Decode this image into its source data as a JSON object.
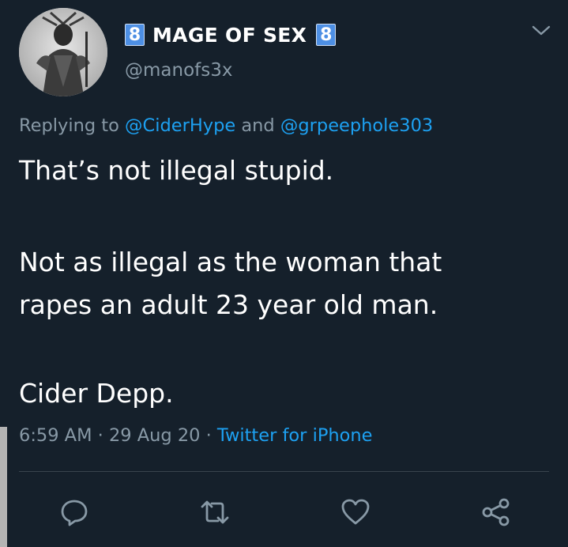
{
  "tweet": {
    "badge_left": "8",
    "display_name": "MAGE OF SEX",
    "badge_right": "8",
    "handle": "@manofs3x",
    "reply_prefix": "Replying to",
    "reply_mention_1": "@CiderHype",
    "reply_and": "and",
    "reply_mention_2": "@grpeephole303",
    "line_1": "That’s not illegal stupid.",
    "line_2": "Not as illegal as the woman that",
    "line_3": "rapes an adult 23 year old man.",
    "line_4": "Cider Depp.",
    "time": "6:59 AM",
    "sep_1": "·",
    "date": "29 Aug 20",
    "sep_2": "·",
    "source": "Twitter for iPhone"
  },
  "icons": {
    "more": "chevron-down-icon",
    "reply": "reply-icon",
    "retweet": "retweet-icon",
    "like": "heart-icon",
    "share": "share-icon"
  },
  "colors": {
    "background": "#15202b",
    "text": "#ffffff",
    "secondary": "#8899a6",
    "link": "#1da1f2",
    "badge": "#4d8fe4",
    "divider": "#38444d"
  }
}
